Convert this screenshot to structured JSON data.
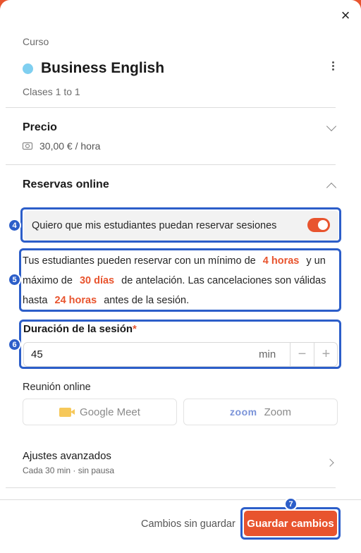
{
  "course": {
    "section_label": "Curso",
    "name": "Business English",
    "dot_color": "#7fcff0",
    "type": "Clases 1 to 1"
  },
  "price": {
    "title": "Precio",
    "value": "30,00 € / hora"
  },
  "online_booking": {
    "title": "Reservas online",
    "toggle_label": "Quiero que mis estudiantes puedan reservar sesiones",
    "toggle_on": true,
    "text_part1": "Tus estudiantes pueden reservar con un mínimo de",
    "min_notice": "4 horas",
    "text_part2": "y un máximo de",
    "max_notice": "30 días",
    "text_part3": "de antelación. Las cancelaciones son válidas hasta",
    "cancel_notice": "24 horas",
    "text_part4": "antes de la sesión."
  },
  "duration": {
    "label": "Duración de la sesión",
    "required_mark": "*",
    "value": "45",
    "unit": "min",
    "minus": "−",
    "plus": "+"
  },
  "meeting": {
    "label": "Reunión online",
    "google_meet": "Google Meet",
    "zoom_logo": "zoom",
    "zoom": "Zoom"
  },
  "advanced": {
    "title": "Ajustes avanzados",
    "subtitle": "Cada 30 min · sin pausa"
  },
  "footer": {
    "unsaved": "Cambios sin guardar",
    "save": "Guardar cambios"
  },
  "markers": {
    "toggle": "4",
    "booking_text": "5",
    "duration": "6",
    "save": "7"
  },
  "colors": {
    "accent": "#e8542e",
    "highlight": "#2c5ec9"
  }
}
